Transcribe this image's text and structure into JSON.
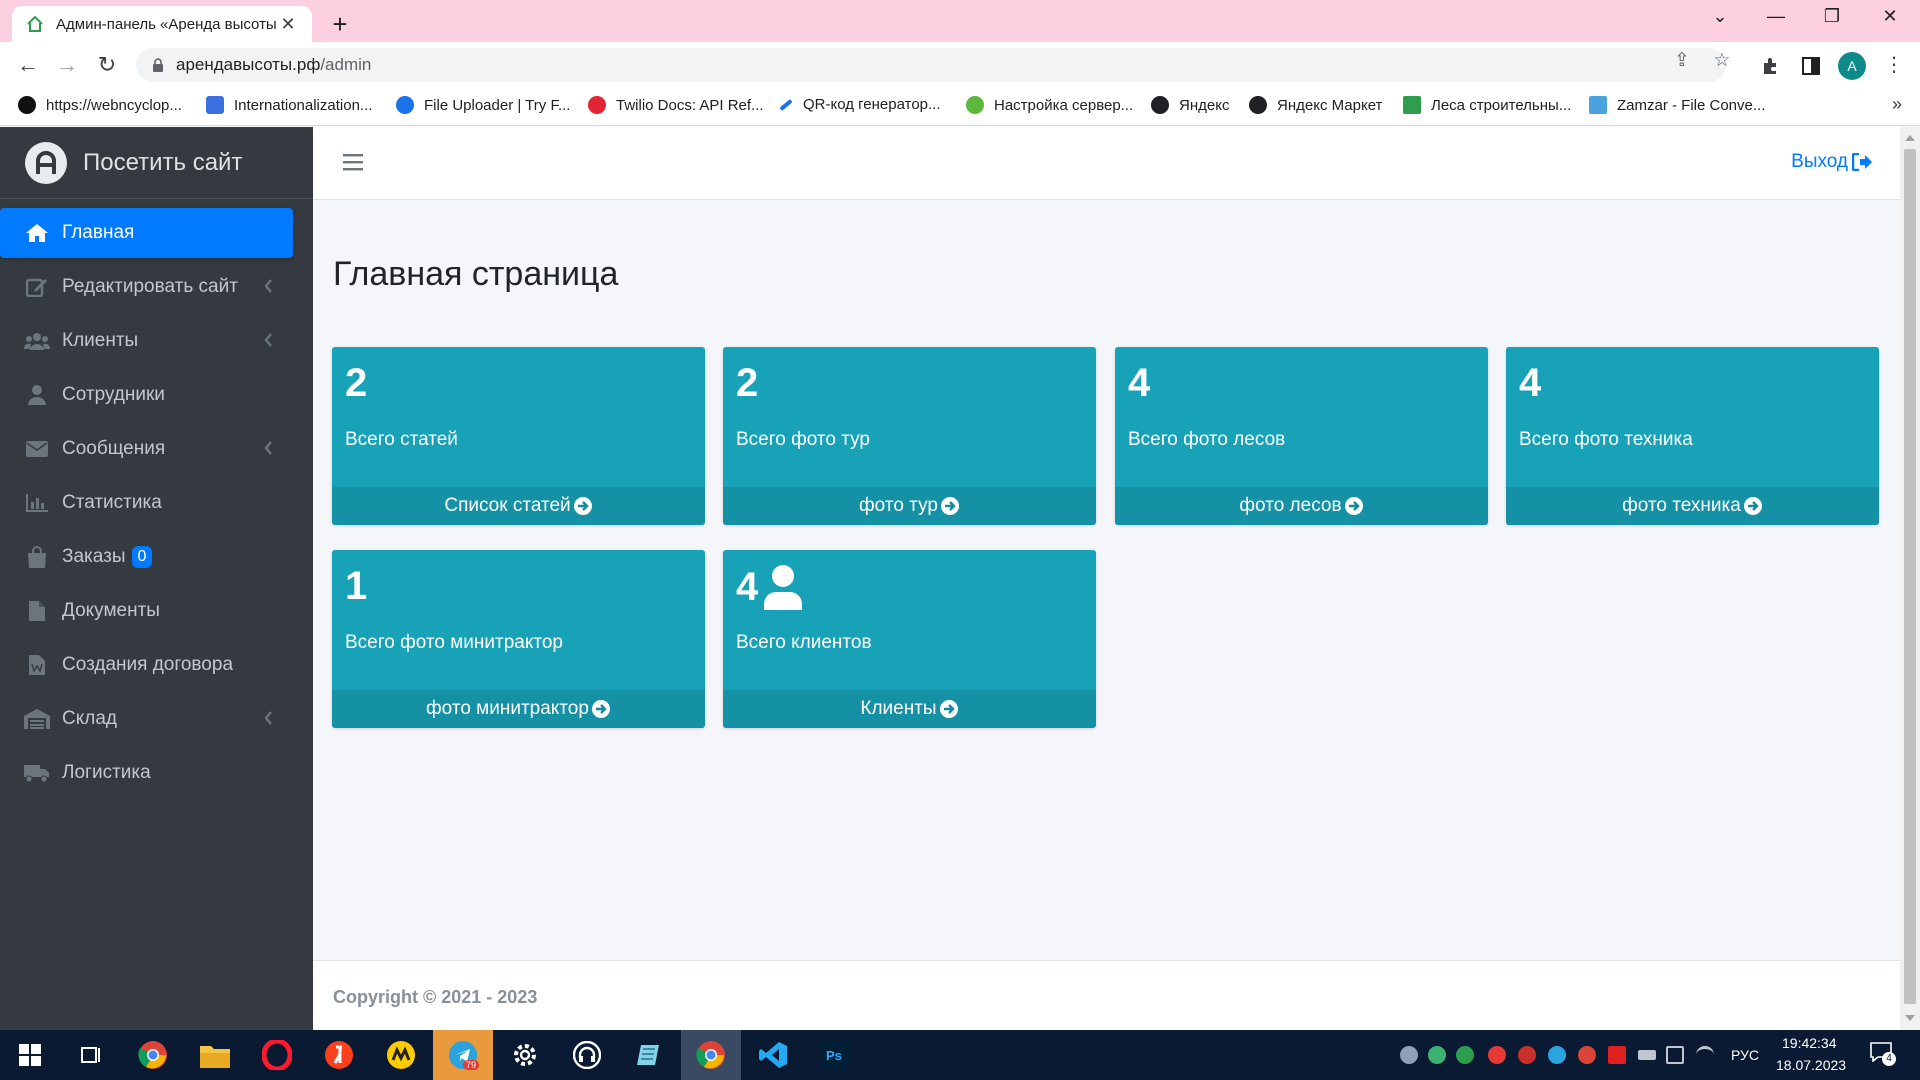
{
  "browser": {
    "tab_title": "Админ-панель «Аренда высоты",
    "tab_close": "✕",
    "new_tab": "+",
    "url_host": "арендавысоты.рф",
    "url_path": "/admin",
    "avatar_letter": "A",
    "bookmarks": [
      {
        "label": "https://webncyclop...",
        "icon": "circle-a-icon",
        "color": "#111111"
      },
      {
        "label": "Internationalization...",
        "icon": "a-triangle-icon",
        "color": "#3b6fe0"
      },
      {
        "label": "File Uploader | Try F...",
        "icon": "upload-shield-icon",
        "color": "#1a73e8"
      },
      {
        "label": "Twilio Docs: API Ref...",
        "icon": "twilio-icon",
        "color": "#e22533"
      },
      {
        "label": "QR-код генератор...",
        "icon": "pen-icon",
        "color": "#1a73e8"
      },
      {
        "label": "Настройка сервер...",
        "icon": "leaf-icon",
        "color": "#5bb83c"
      },
      {
        "label": "Яндекс",
        "icon": "globe-icon",
        "color": "#202124"
      },
      {
        "label": "Яндекс Маркет",
        "icon": "globe-icon",
        "color": "#202124"
      },
      {
        "label": "Леса строительны...",
        "icon": "house-icon",
        "color": "#2e9d4e"
      },
      {
        "label": "Zamzar - File Conve...",
        "icon": "zamzar-icon",
        "color": "#4aa3df"
      }
    ],
    "bookmarks_more": "»"
  },
  "sidebar": {
    "brand": "Посетить сайт",
    "items": [
      {
        "label": "Главная",
        "icon": "home-icon",
        "active": true,
        "chevron": false
      },
      {
        "label": "Редактировать сайт",
        "icon": "edit-icon",
        "active": false,
        "chevron": true
      },
      {
        "label": "Клиенты",
        "icon": "users-icon",
        "active": false,
        "chevron": true
      },
      {
        "label": "Сотрудники",
        "icon": "user-icon",
        "active": false,
        "chevron": false
      },
      {
        "label": "Сообщения",
        "icon": "envelope-icon",
        "active": false,
        "chevron": true
      },
      {
        "label": "Статистика",
        "icon": "chart-icon",
        "active": false,
        "chevron": false
      },
      {
        "label": "Заказы",
        "icon": "shopping-bag-icon",
        "active": false,
        "chevron": false,
        "badge": "0"
      },
      {
        "label": "Документы",
        "icon": "file-icon",
        "active": false,
        "chevron": false
      },
      {
        "label": "Создания договора",
        "icon": "word-file-icon",
        "active": false,
        "chevron": false
      },
      {
        "label": "Склад",
        "icon": "warehouse-icon",
        "active": false,
        "chevron": true
      },
      {
        "label": "Логистика",
        "icon": "truck-icon",
        "active": false,
        "chevron": false
      }
    ]
  },
  "header": {
    "logout_label": "Выход"
  },
  "main": {
    "title": "Главная страница",
    "cards": [
      {
        "count": "2",
        "label": "Всего статей",
        "link": "Список статей",
        "user_icon": false
      },
      {
        "count": "2",
        "label": "Всего фото тур",
        "link": "фото тур",
        "user_icon": false
      },
      {
        "count": "4",
        "label": "Всего фото лесов",
        "link": "фото лесов",
        "user_icon": false
      },
      {
        "count": "4",
        "label": "Всего фото техника",
        "link": "фото техника",
        "user_icon": false
      },
      {
        "count": "1",
        "label": "Всего фото минитрактор",
        "link": "фото минитрактор",
        "user_icon": false
      },
      {
        "count": "4",
        "label": "Всего клиентов",
        "link": "Клиенты",
        "user_icon": true
      }
    ]
  },
  "footer": {
    "copyright": "Copyright © 2021 - 2023"
  },
  "taskbar": {
    "language": "РУС",
    "time": "19:42:34",
    "date": "18.07.2023",
    "notification_count": "4",
    "telegram_badge": "79"
  },
  "colors": {
    "sidebar_bg": "#343a40",
    "accent": "#007bff",
    "card_bg": "#17a2b8"
  }
}
